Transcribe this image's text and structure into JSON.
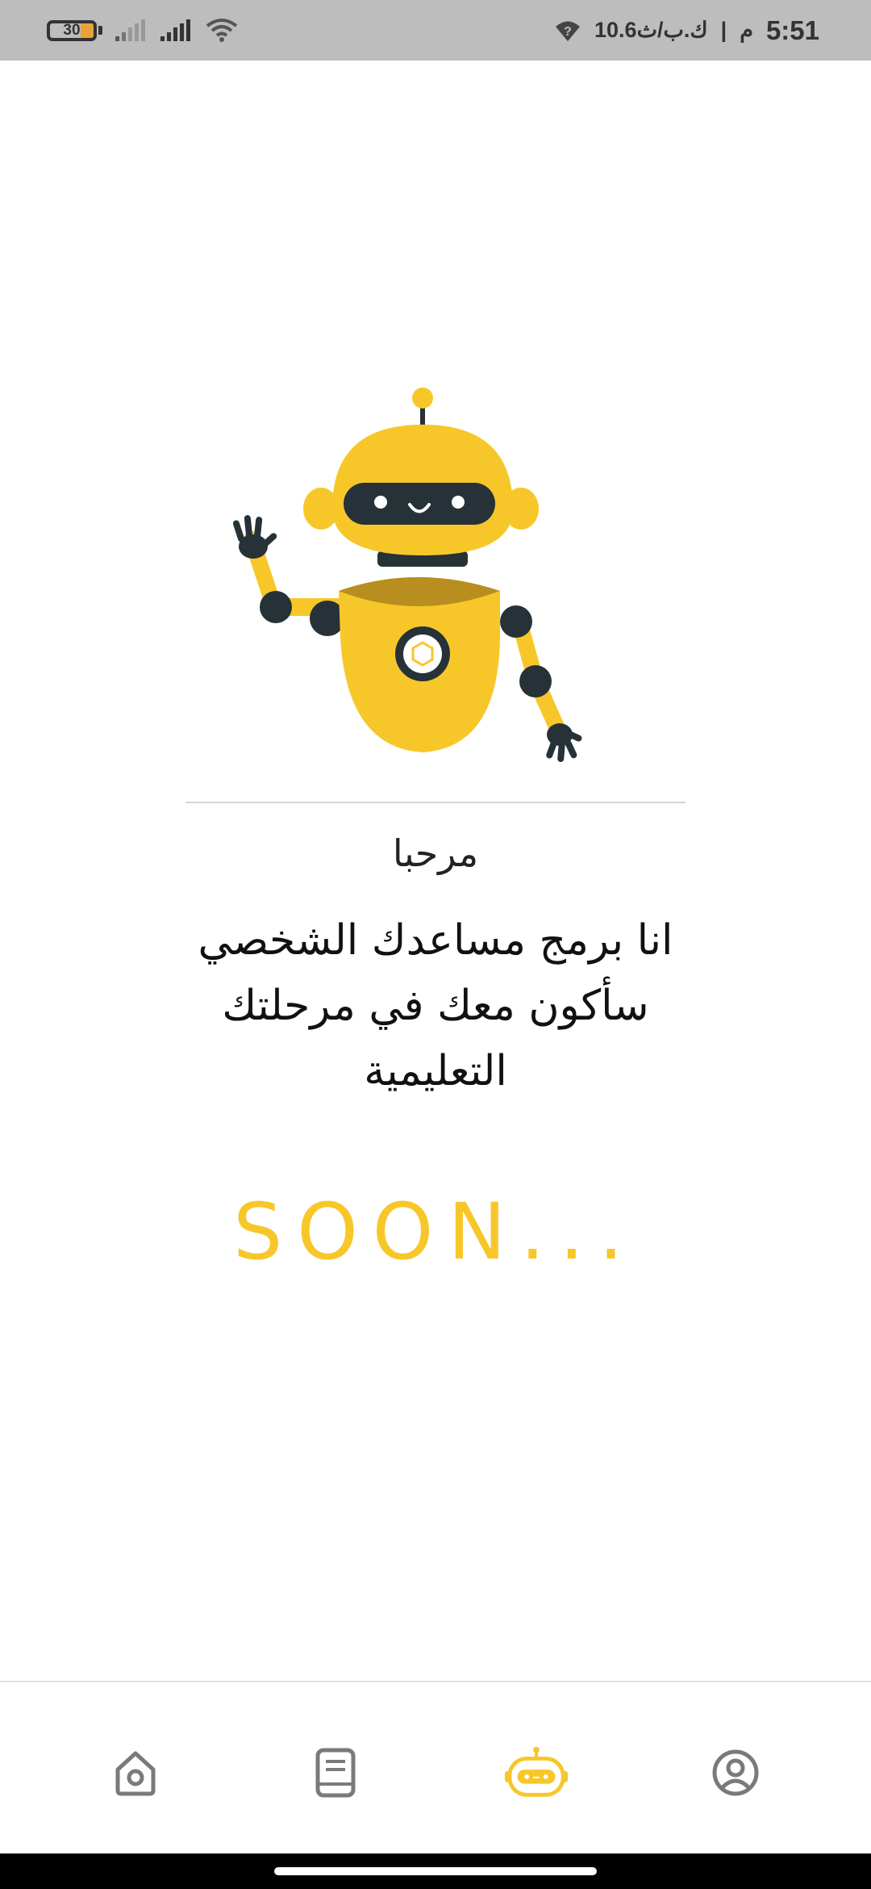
{
  "status_bar": {
    "time": "5:51",
    "ampm": "م",
    "separator": "|",
    "data_speed": "10.6ك.ب/ث",
    "battery_level": "30",
    "icons": [
      "battery-icon",
      "signal-icon",
      "signal-icon",
      "wifi-icon",
      "wifi-question-icon"
    ]
  },
  "content": {
    "greeting": "مرحبا",
    "intro": "انا برمج مساعدك الشخصي سأكون معك في مرحلتك التعليمية",
    "soon": "SOON..."
  },
  "nav": {
    "items": [
      {
        "name": "home",
        "icon": "home-icon",
        "active": false
      },
      {
        "name": "book",
        "icon": "book-icon",
        "active": false
      },
      {
        "name": "bot",
        "icon": "robot-icon",
        "active": true
      },
      {
        "name": "profile",
        "icon": "profile-icon",
        "active": false
      }
    ],
    "active_color": "#f7c72a",
    "inactive_color": "#7a7a7a"
  },
  "colors": {
    "accent": "#f7c72a",
    "robot_dark": "#263238"
  }
}
